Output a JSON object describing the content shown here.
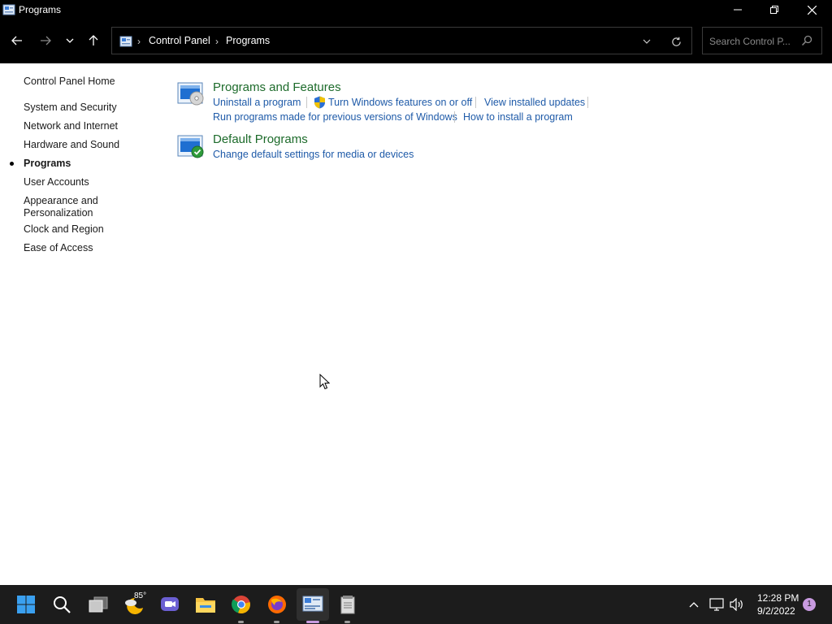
{
  "window": {
    "title": "Programs",
    "icon": "control-panel-icon"
  },
  "nav": {
    "breadcrumbs": [
      "Control Panel",
      "Programs"
    ],
    "search_placeholder": "Search Control P..."
  },
  "sidebar": {
    "home": "Control Panel Home",
    "items": [
      {
        "label": "System and Security",
        "active": false
      },
      {
        "label": "Network and Internet",
        "active": false
      },
      {
        "label": "Hardware and Sound",
        "active": false
      },
      {
        "label": "Programs",
        "active": true
      },
      {
        "label": "User Accounts",
        "active": false
      },
      {
        "label": "Appearance and\nPersonalization",
        "active": false
      },
      {
        "label": "Clock and Region",
        "active": false
      },
      {
        "label": "Ease of Access",
        "active": false
      }
    ]
  },
  "categories": [
    {
      "title": "Programs and Features",
      "icon": "programs-and-features-icon",
      "links": [
        "Uninstall a program",
        "Turn Windows features on or off",
        "View installed updates",
        "Run programs made for previous versions of Windows",
        "How to install a program"
      ]
    },
    {
      "title": "Default Programs",
      "icon": "default-programs-icon",
      "links": [
        "Change default settings for media or devices"
      ]
    }
  ],
  "taskbar": {
    "weather_temp": "85°",
    "apps": [
      "start",
      "search",
      "task-view",
      "weather",
      "teams-chat",
      "file-explorer",
      "chrome",
      "firefox",
      "control-panel",
      "notepad-app"
    ],
    "clock_time": "12:28 PM",
    "clock_date": "9/2/2022",
    "notification_count": "1"
  },
  "colors": {
    "link": "#1e5aa8",
    "category_title": "#1d6b2b",
    "taskbar_bg": "#1c1c1c",
    "accent": "#c89ae0"
  }
}
